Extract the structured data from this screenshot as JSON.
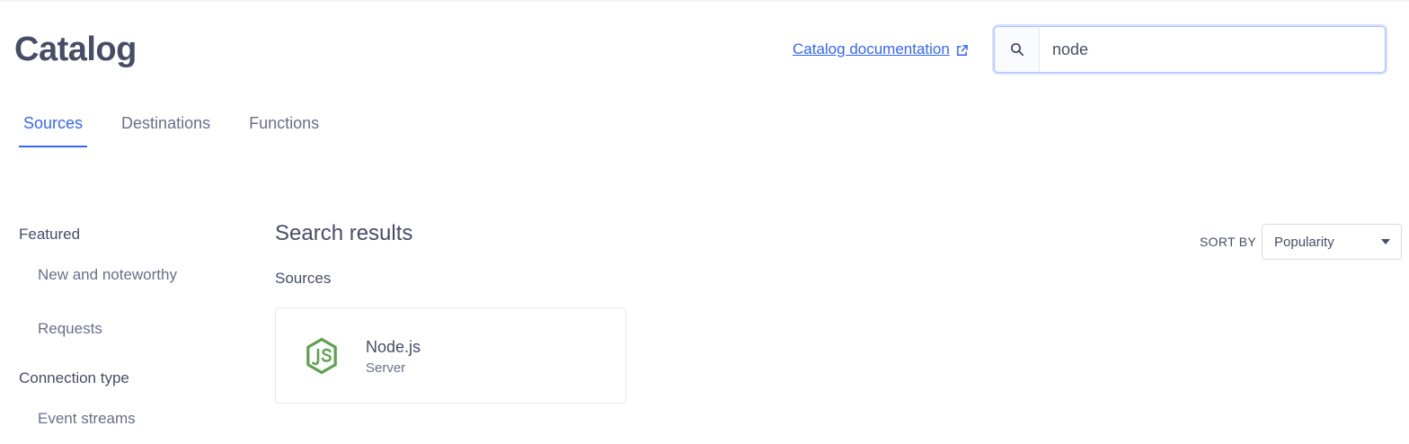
{
  "header": {
    "title": "Catalog",
    "doc_link": "Catalog documentation",
    "search": {
      "value": "node",
      "placeholder": ""
    }
  },
  "tabs": [
    {
      "label": "Sources",
      "active": true
    },
    {
      "label": "Destinations",
      "active": false
    },
    {
      "label": "Functions",
      "active": false
    }
  ],
  "sidebar": {
    "sections": [
      {
        "heading": "Featured",
        "items": [
          "New and noteworthy",
          "Requests"
        ]
      },
      {
        "heading": "Connection type",
        "items": [
          "Event streams"
        ]
      }
    ]
  },
  "results": {
    "title": "Search results",
    "section": "Sources",
    "sort_label": "SORT BY",
    "sort_value": "Popularity",
    "cards": [
      {
        "name": "Node.js",
        "category": "Server",
        "icon": "nodejs-icon"
      }
    ]
  },
  "colors": {
    "accent": "#3366ff",
    "text": "#474d66",
    "muted": "#696f8c",
    "nodejs_green": "#5fa04e"
  }
}
